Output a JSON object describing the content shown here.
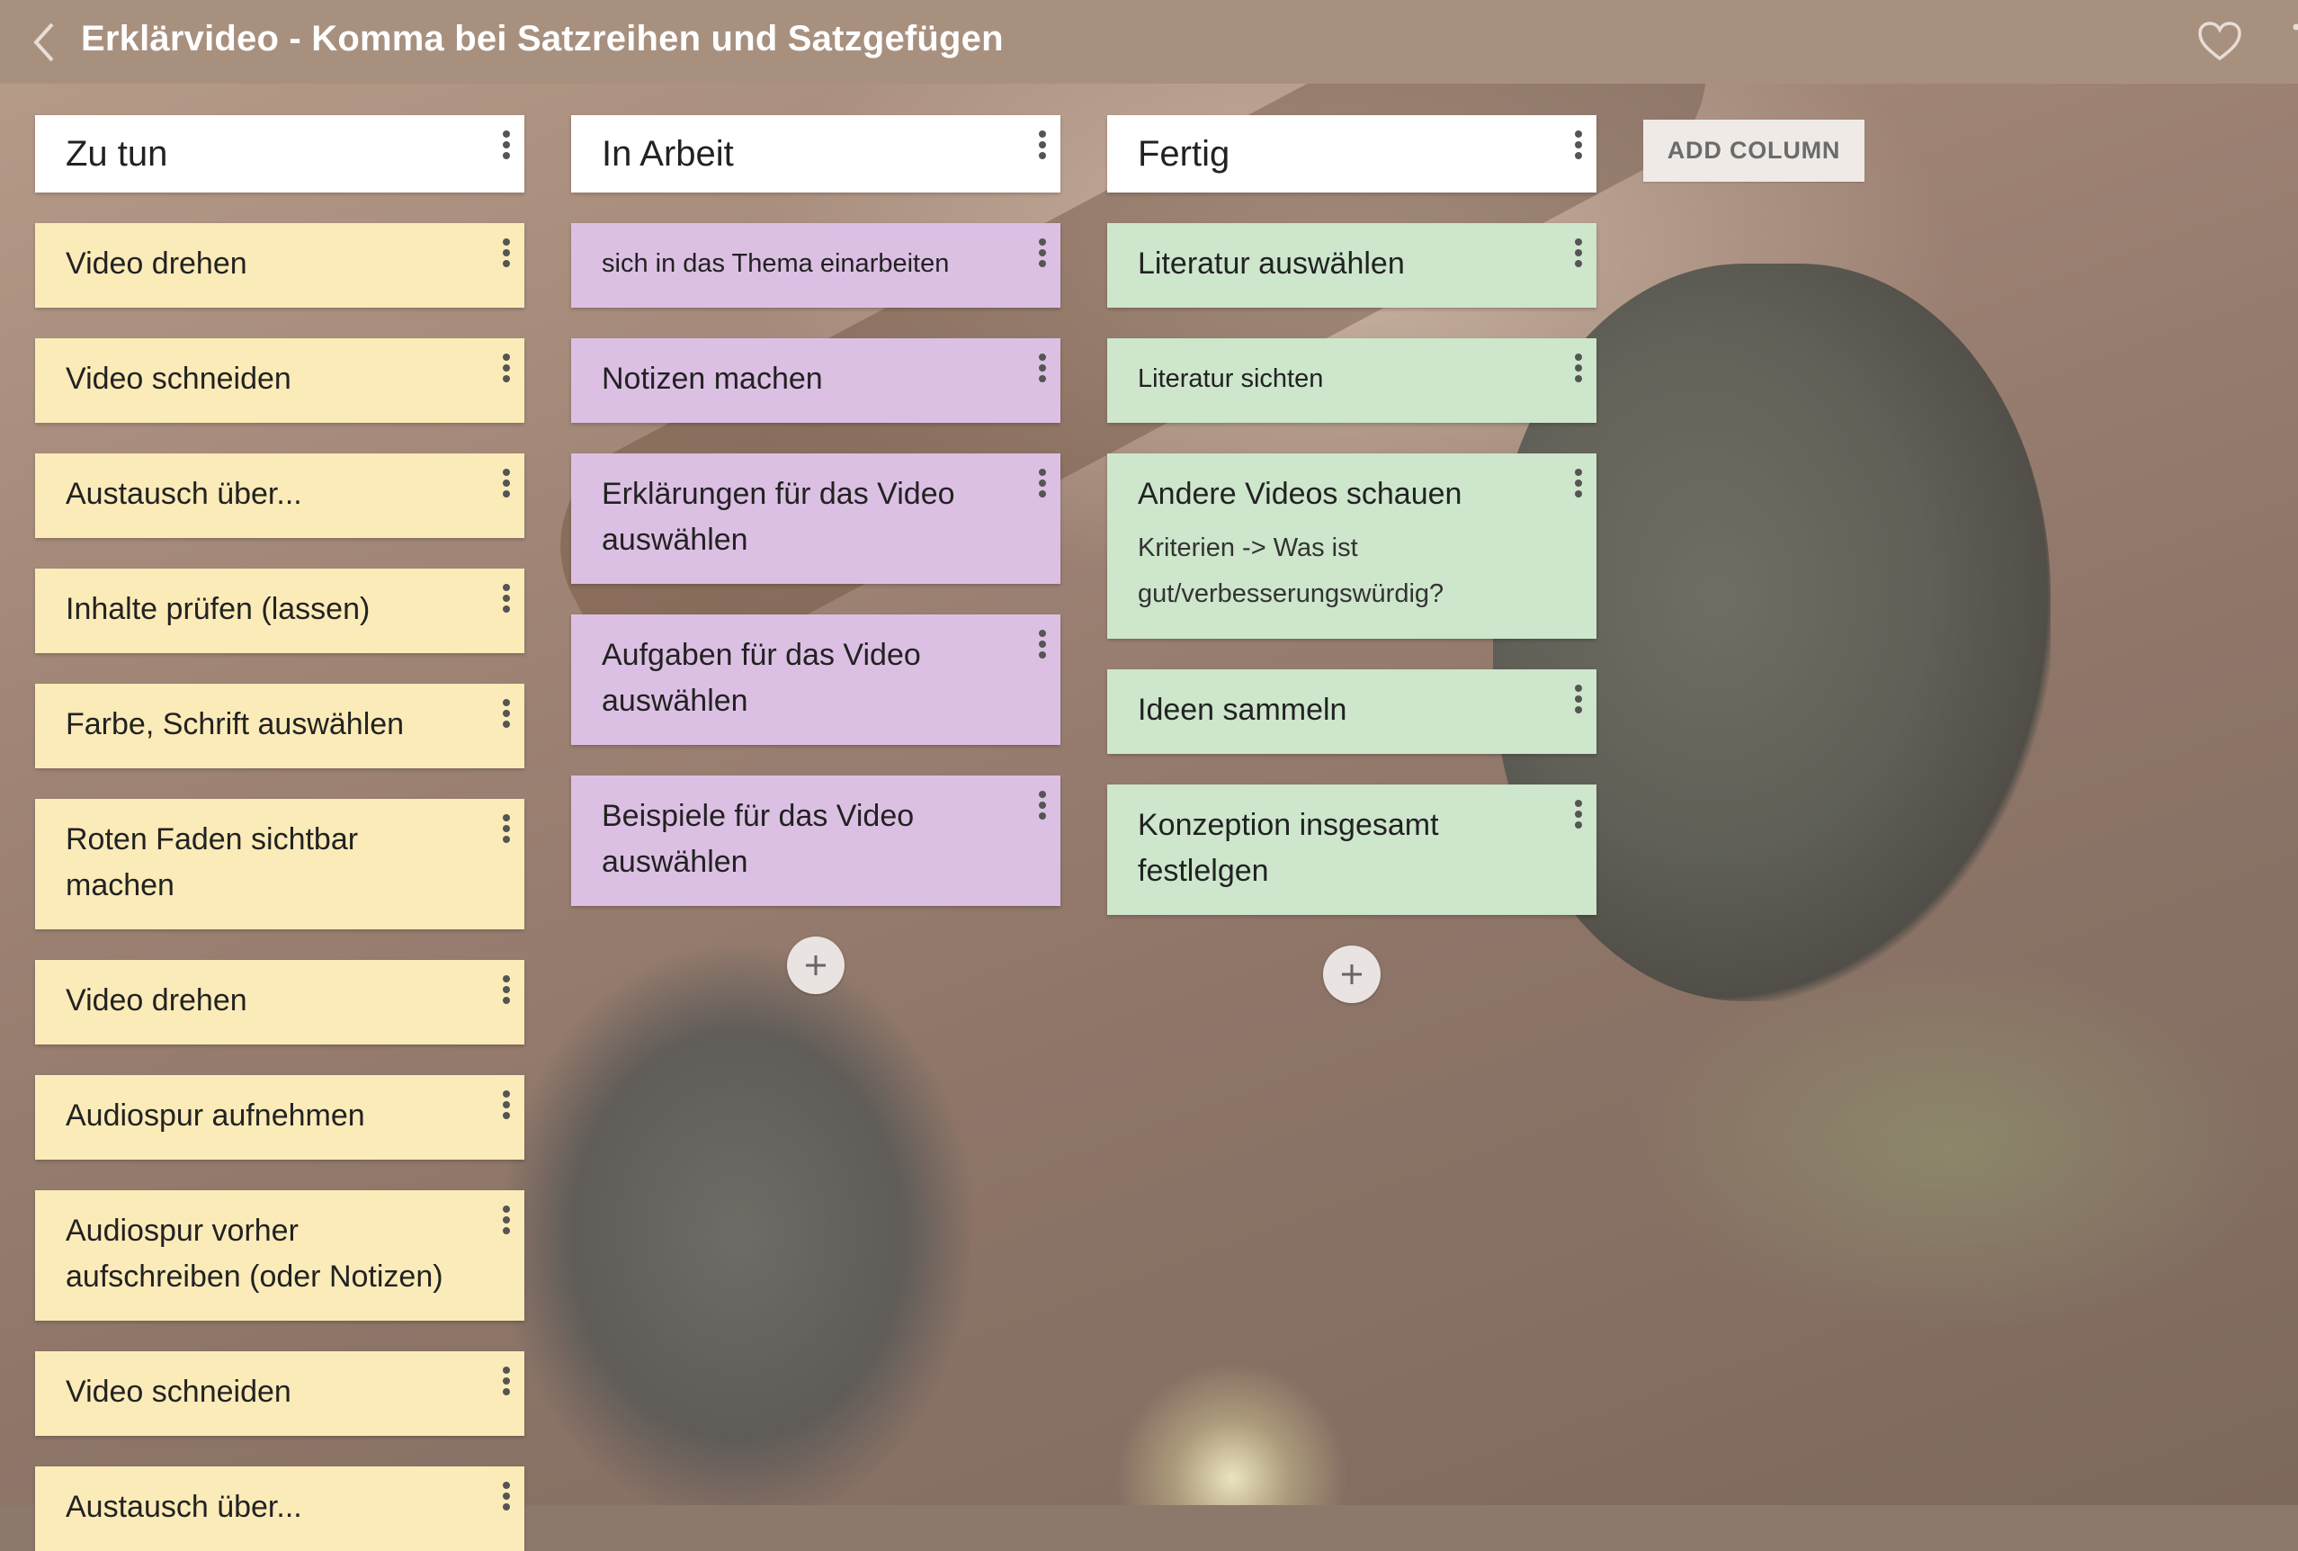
{
  "header": {
    "title": "Erklärvideo - Komma bei Satzreihen und Satzgefügen",
    "back_icon": "chevron-left-icon",
    "favorite_icon": "heart-outline-icon"
  },
  "add_column_label": "ADD COLUMN",
  "colors": {
    "topbar": "#a8907f",
    "todo": "#fbebb8",
    "doing": "#dcc0e4",
    "done": "#cde6cc"
  },
  "columns": [
    {
      "title": "Zu tun",
      "cards": [
        {
          "title": "Video drehen"
        },
        {
          "title": "Video schneiden"
        },
        {
          "title": "Austausch über..."
        },
        {
          "title": "Inhalte prüfen (lassen)"
        },
        {
          "title": "Farbe, Schrift auswählen"
        },
        {
          "title": "Roten Faden sichtbar machen"
        },
        {
          "title": "Video drehen"
        },
        {
          "title": "Audiospur aufnehmen"
        },
        {
          "title": "Audiospur vorher aufschreiben (oder Notizen)"
        },
        {
          "title": "Video schneiden"
        },
        {
          "title": "Austausch über..."
        }
      ]
    },
    {
      "title": "In Arbeit",
      "cards": [
        {
          "title": "sich in das Thema einarbeiten"
        },
        {
          "title": "Notizen machen"
        },
        {
          "title": "Erklärungen für das Video auswählen"
        },
        {
          "title": "Aufgaben für das Video auswählen"
        },
        {
          "title": "Beispiele für das Video auswählen"
        }
      ]
    },
    {
      "title": "Fertig",
      "cards": [
        {
          "title": "Literatur auswählen"
        },
        {
          "title": "Literatur sichten"
        },
        {
          "title": "Andere Videos schauen",
          "desc": "Kriterien -> Was ist gut/verbesserungswürdig?"
        },
        {
          "title": "Ideen sammeln"
        },
        {
          "title": "Konzeption insgesamt festlelgen"
        }
      ]
    }
  ]
}
